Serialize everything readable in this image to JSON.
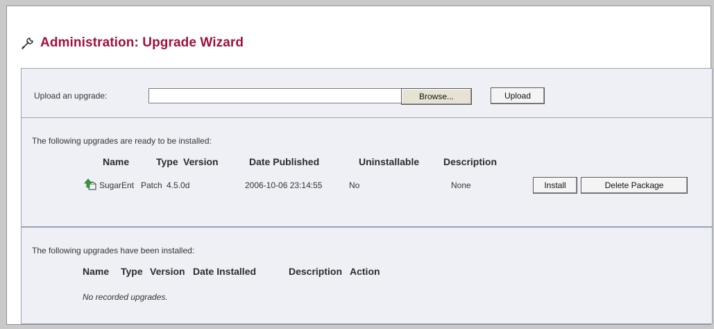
{
  "page": {
    "title": "Administration: Upgrade Wizard",
    "title_icon": "wrench-icon",
    "title_color": "#a0103a"
  },
  "upload": {
    "label": "Upload an upgrade:",
    "input_value": "",
    "browse_label": "Browse...",
    "upload_label": "Upload"
  },
  "ready": {
    "section_label": "The following upgrades are ready to be installed:",
    "columns": [
      "Name",
      "Type",
      "Version",
      "Date Published",
      "Uninstallable",
      "Description"
    ],
    "rows": [
      {
        "icon": "upgrade-package-icon",
        "name": "SugarEnt",
        "type": "Patch",
        "version": "4.5.0d",
        "date_published": "2006-10-06 23:14:55",
        "uninstallable": "No",
        "description": "None",
        "install_label": "Install",
        "delete_label": "Delete Package"
      }
    ]
  },
  "installed": {
    "section_label": "The following upgrades have been installed:",
    "columns": [
      "Name",
      "Type",
      "Version",
      "Date Installed",
      "Description",
      "Action"
    ],
    "empty_message": "No recorded upgrades."
  }
}
